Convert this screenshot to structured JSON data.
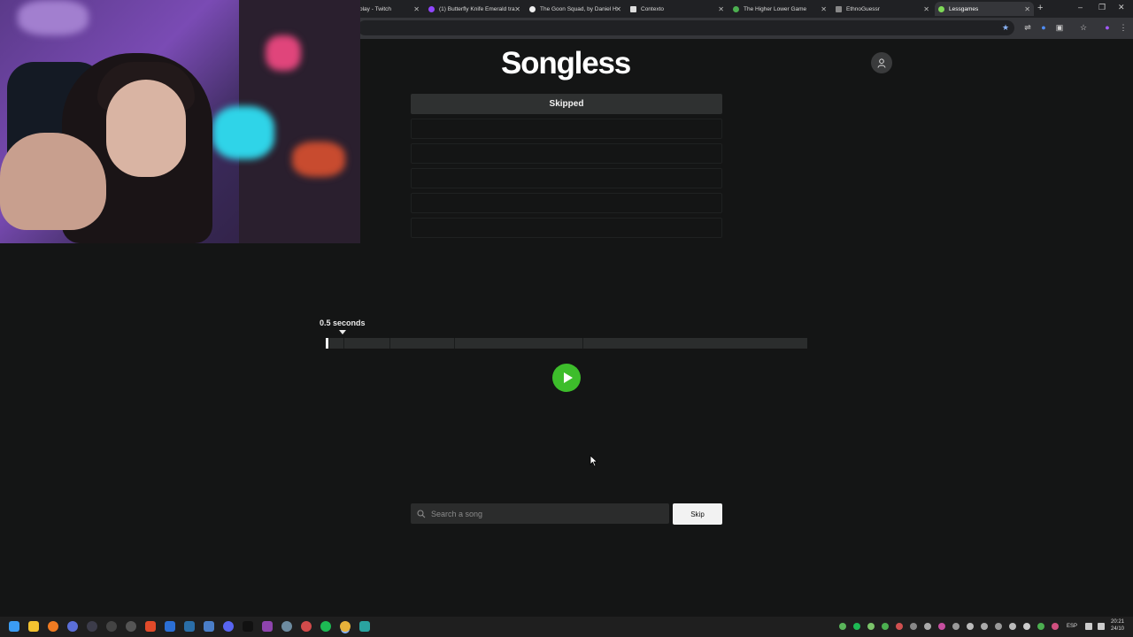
{
  "browser": {
    "tabs": [
      {
        "title": "play - Twitch",
        "favicon_color": "#9146ff"
      },
      {
        "title": "(1) Butterfly Knife Emerald tra",
        "favicon_color": "#9146ff"
      },
      {
        "title": "The Goon Squad, by Daniel H",
        "favicon_color": "#eeeeee"
      },
      {
        "title": "Contexto",
        "favicon_color": "#dddddd"
      },
      {
        "title": "The Higher Lower Game",
        "favicon_color": "#4caf50"
      },
      {
        "title": "EthnoGuessr",
        "favicon_color": "#888888"
      },
      {
        "title": "Lessgames",
        "favicon_color": "#7ed957"
      }
    ],
    "new_tab": "+",
    "controls": {
      "minimize": "–",
      "restore": "❐",
      "close": "✕"
    }
  },
  "app": {
    "logo": "Songless",
    "guesses": [
      "Skipped",
      "",
      "",
      "",
      "",
      ""
    ],
    "duration_label": "0.5 seconds",
    "progress_fraction": 0.004,
    "search_placeholder": "Search a song",
    "skip_label": "Skip",
    "accent_color": "#3dbd2b"
  },
  "taskbar": {
    "lang": "ESP",
    "time": "20:21",
    "date": "24/10"
  }
}
